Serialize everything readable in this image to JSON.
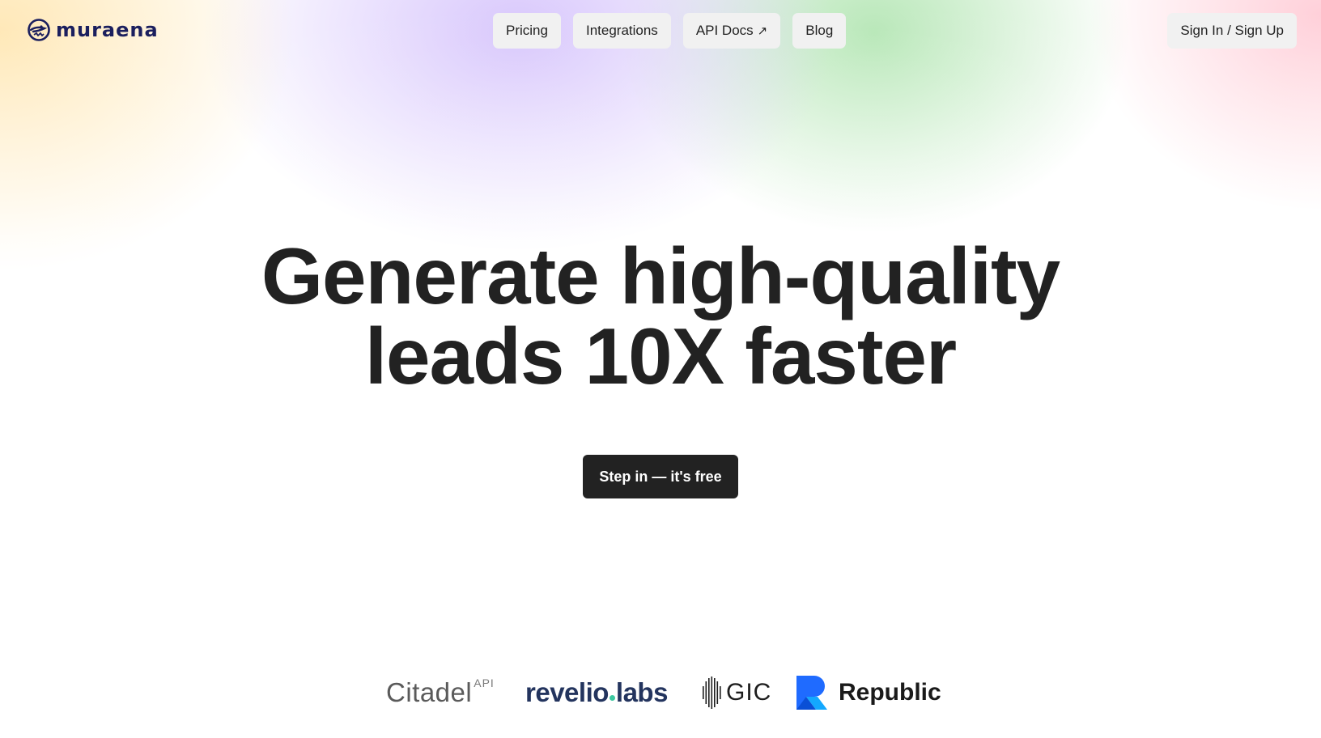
{
  "header": {
    "logo_text": "muraena",
    "nav": [
      {
        "label": "Pricing"
      },
      {
        "label": "Integrations"
      },
      {
        "label": "API Docs",
        "icon": "arrow-up-right-icon",
        "icon_glyph": "↗"
      },
      {
        "label": "Blog"
      }
    ],
    "signin_label": "Sign In / Sign Up"
  },
  "hero": {
    "title_line1": "Generate high-quality",
    "title_line2": "leads 10X faster",
    "cta_label": "Step in — it's free"
  },
  "logos": {
    "citadel": "Citadel",
    "citadel_sup": "API",
    "revelio_part1": "revelio",
    "revelio_part2": "labs",
    "gic": "GIC",
    "republic": "Republic"
  },
  "colors": {
    "text": "#222222",
    "cta_bg": "#222222",
    "nav_bg": "#f1f1f1",
    "logo_navy": "#1b1f5e",
    "revelio_navy": "#23345e",
    "republic_blue": "#1f6bff"
  }
}
